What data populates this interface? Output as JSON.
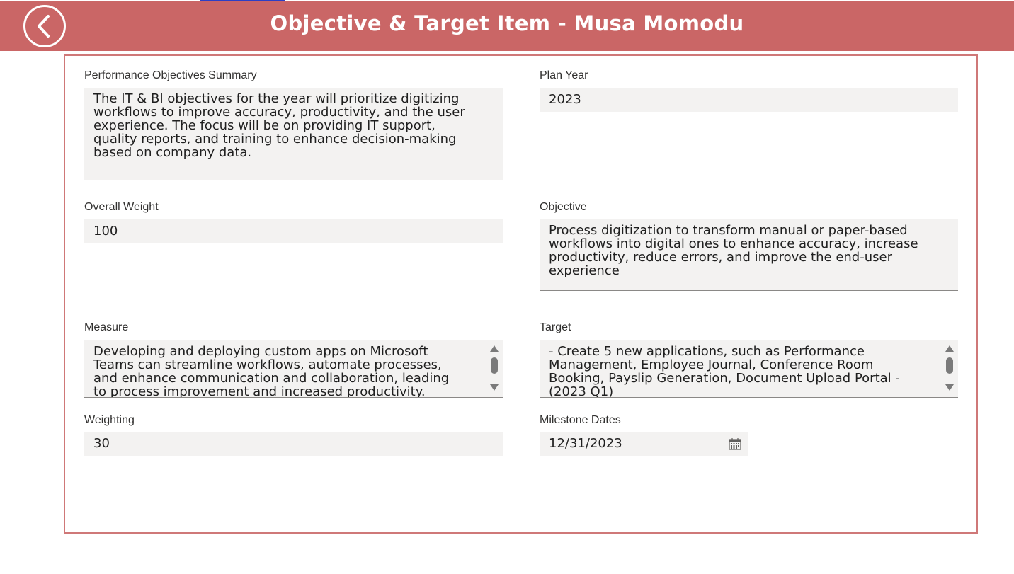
{
  "header": {
    "title": "Objective & Target Item - Musa Momodu",
    "back_icon": "chevron-left-icon",
    "background": "#ca6666"
  },
  "form": {
    "summary": {
      "label": "Performance Objectives Summary",
      "value": "The IT & BI objectives for the year will prioritize digitizing\nworkflows to improve accuracy, productivity, and the user\nexperience. The focus will be on providing IT support,\nquality reports, and training to enhance decision-making\nbased on company data."
    },
    "plan_year": {
      "label": "Plan Year",
      "value": "2023"
    },
    "overall_weight": {
      "label": "Overall Weight",
      "value": "100"
    },
    "objective": {
      "label": "Objective",
      "value": "Process digitization to transform manual or paper-based\nworkflows into digital ones to enhance accuracy, increase\nproductivity, reduce errors, and improve the end-user\nexperience"
    },
    "measure": {
      "label": "Measure",
      "value": "Developing and deploying custom apps on Microsoft\nTeams can streamline workflows, automate processes,\nand enhance communication and collaboration, leading\nto process improvement and increased productivity."
    },
    "target": {
      "label": "Target",
      "value": "- Create 5 new applications, such as Performance\nManagement, Employee Journal, Conference Room\nBooking, Payslip Generation, Document Upload Portal -\n(2023 Q1)"
    },
    "weighting": {
      "label": "Weighting",
      "value": "30"
    },
    "milestone_dates": {
      "label": "Milestone Dates",
      "value": "12/31/2023",
      "icon": "calendar-icon"
    }
  }
}
